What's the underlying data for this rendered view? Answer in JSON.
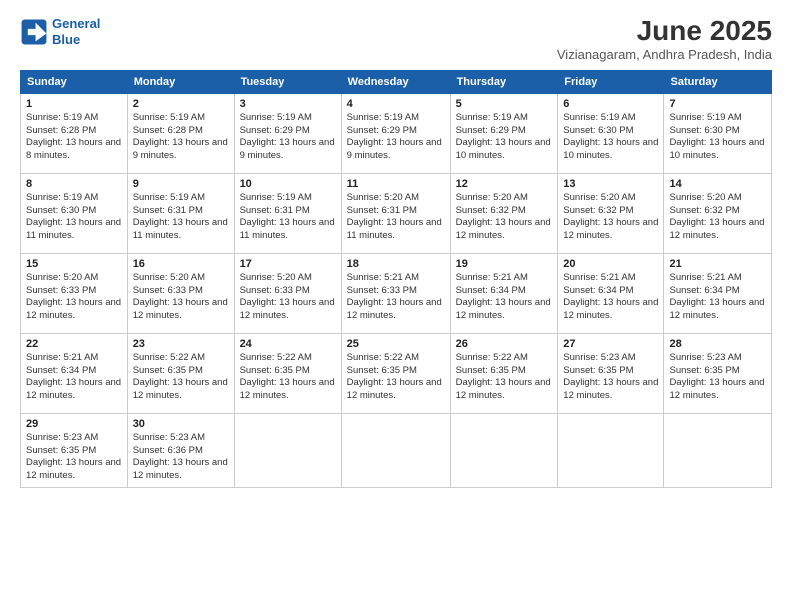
{
  "logo": {
    "line1": "General",
    "line2": "Blue"
  },
  "title": "June 2025",
  "location": "Vizianagaram, Andhra Pradesh, India",
  "headers": [
    "Sunday",
    "Monday",
    "Tuesday",
    "Wednesday",
    "Thursday",
    "Friday",
    "Saturday"
  ],
  "weeks": [
    [
      {
        "day": "1",
        "sunrise": "5:19 AM",
        "sunset": "6:28 PM",
        "daylight": "13 hours and 8 minutes."
      },
      {
        "day": "2",
        "sunrise": "5:19 AM",
        "sunset": "6:28 PM",
        "daylight": "13 hours and 9 minutes."
      },
      {
        "day": "3",
        "sunrise": "5:19 AM",
        "sunset": "6:29 PM",
        "daylight": "13 hours and 9 minutes."
      },
      {
        "day": "4",
        "sunrise": "5:19 AM",
        "sunset": "6:29 PM",
        "daylight": "13 hours and 9 minutes."
      },
      {
        "day": "5",
        "sunrise": "5:19 AM",
        "sunset": "6:29 PM",
        "daylight": "13 hours and 10 minutes."
      },
      {
        "day": "6",
        "sunrise": "5:19 AM",
        "sunset": "6:30 PM",
        "daylight": "13 hours and 10 minutes."
      },
      {
        "day": "7",
        "sunrise": "5:19 AM",
        "sunset": "6:30 PM",
        "daylight": "13 hours and 10 minutes."
      }
    ],
    [
      {
        "day": "8",
        "sunrise": "5:19 AM",
        "sunset": "6:30 PM",
        "daylight": "13 hours and 11 minutes."
      },
      {
        "day": "9",
        "sunrise": "5:19 AM",
        "sunset": "6:31 PM",
        "daylight": "13 hours and 11 minutes."
      },
      {
        "day": "10",
        "sunrise": "5:19 AM",
        "sunset": "6:31 PM",
        "daylight": "13 hours and 11 minutes."
      },
      {
        "day": "11",
        "sunrise": "5:20 AM",
        "sunset": "6:31 PM",
        "daylight": "13 hours and 11 minutes."
      },
      {
        "day": "12",
        "sunrise": "5:20 AM",
        "sunset": "6:32 PM",
        "daylight": "13 hours and 12 minutes."
      },
      {
        "day": "13",
        "sunrise": "5:20 AM",
        "sunset": "6:32 PM",
        "daylight": "13 hours and 12 minutes."
      },
      {
        "day": "14",
        "sunrise": "5:20 AM",
        "sunset": "6:32 PM",
        "daylight": "13 hours and 12 minutes."
      }
    ],
    [
      {
        "day": "15",
        "sunrise": "5:20 AM",
        "sunset": "6:33 PM",
        "daylight": "13 hours and 12 minutes."
      },
      {
        "day": "16",
        "sunrise": "5:20 AM",
        "sunset": "6:33 PM",
        "daylight": "13 hours and 12 minutes."
      },
      {
        "day": "17",
        "sunrise": "5:20 AM",
        "sunset": "6:33 PM",
        "daylight": "13 hours and 12 minutes."
      },
      {
        "day": "18",
        "sunrise": "5:21 AM",
        "sunset": "6:33 PM",
        "daylight": "13 hours and 12 minutes."
      },
      {
        "day": "19",
        "sunrise": "5:21 AM",
        "sunset": "6:34 PM",
        "daylight": "13 hours and 12 minutes."
      },
      {
        "day": "20",
        "sunrise": "5:21 AM",
        "sunset": "6:34 PM",
        "daylight": "13 hours and 12 minutes."
      },
      {
        "day": "21",
        "sunrise": "5:21 AM",
        "sunset": "6:34 PM",
        "daylight": "13 hours and 12 minutes."
      }
    ],
    [
      {
        "day": "22",
        "sunrise": "5:21 AM",
        "sunset": "6:34 PM",
        "daylight": "13 hours and 12 minutes."
      },
      {
        "day": "23",
        "sunrise": "5:22 AM",
        "sunset": "6:35 PM",
        "daylight": "13 hours and 12 minutes."
      },
      {
        "day": "24",
        "sunrise": "5:22 AM",
        "sunset": "6:35 PM",
        "daylight": "13 hours and 12 minutes."
      },
      {
        "day": "25",
        "sunrise": "5:22 AM",
        "sunset": "6:35 PM",
        "daylight": "13 hours and 12 minutes."
      },
      {
        "day": "26",
        "sunrise": "5:22 AM",
        "sunset": "6:35 PM",
        "daylight": "13 hours and 12 minutes."
      },
      {
        "day": "27",
        "sunrise": "5:23 AM",
        "sunset": "6:35 PM",
        "daylight": "13 hours and 12 minutes."
      },
      {
        "day": "28",
        "sunrise": "5:23 AM",
        "sunset": "6:35 PM",
        "daylight": "13 hours and 12 minutes."
      }
    ],
    [
      {
        "day": "29",
        "sunrise": "5:23 AM",
        "sunset": "6:35 PM",
        "daylight": "13 hours and 12 minutes."
      },
      {
        "day": "30",
        "sunrise": "5:23 AM",
        "sunset": "6:36 PM",
        "daylight": "13 hours and 12 minutes."
      },
      null,
      null,
      null,
      null,
      null
    ]
  ],
  "labels": {
    "sunrise": "Sunrise:",
    "sunset": "Sunset:",
    "daylight": "Daylight:"
  }
}
